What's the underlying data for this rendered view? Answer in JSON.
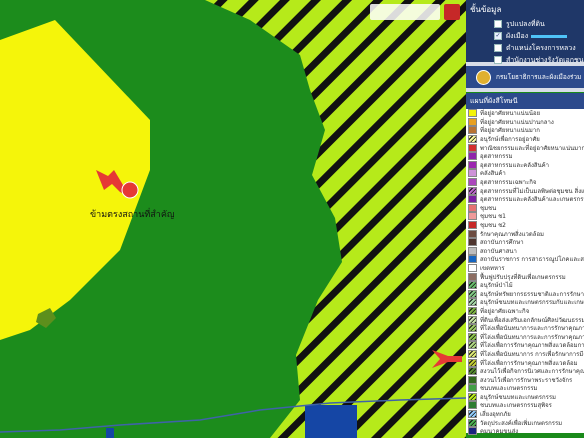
{
  "map": {
    "place_label": "ข้ามตรงสถานที่สำคัญ",
    "colors": {
      "urban": "#1c8c1c",
      "residential": "#f5f50a",
      "agri_hatch": "#b6ea1a",
      "water": "#1546a5",
      "river": "#3f63a8"
    }
  },
  "layers_panel": {
    "title": "ชั้นข้อมูล",
    "items": [
      {
        "label": "รูปแปลงที่ดิน",
        "checked": false
      },
      {
        "label": "ผังเมือง",
        "checked": true
      },
      {
        "label": "ตำแหน่งโครงการหลวง",
        "checked": false
      },
      {
        "label": "สำนักงานช่างรังวัดเอกชน",
        "checked": false
      }
    ]
  },
  "brand": {
    "title": "กรมโยธาธิการและผังเมืองร่วม"
  },
  "legend": {
    "title": "แผนที่ผังสีโทษนี",
    "items": [
      {
        "label": "ที่อยู่อาศัยหนาแน่นน้อย",
        "color": "#f5f50a",
        "hatch": false
      },
      {
        "label": "ที่อยู่อาศัยหนาแน่นปานกลาง",
        "color": "#e8a020",
        "hatch": false
      },
      {
        "label": "ที่อยู่อาศัยหนาแน่นมาก",
        "color": "#b87333",
        "hatch": false
      },
      {
        "label": "อนุรักษ์เพื่อการอยู่อาศัย",
        "color": "#f5f59a",
        "hatch": true
      },
      {
        "label": "พาณิชยกรรมและที่อยู่อาศัยหนาแน่นมาก",
        "color": "#d32f2f",
        "hatch": false
      },
      {
        "label": "อุตสาหกรรม",
        "color": "#8e24aa",
        "hatch": false
      },
      {
        "label": "อุตสาหกรรมและคลังสินค้า",
        "color": "#9c27b0",
        "hatch": false
      },
      {
        "label": "คลังสินค้า",
        "color": "#ce93d8",
        "hatch": false
      },
      {
        "label": "อุตสาหกรรมเฉพาะกิจ",
        "color": "#ab47bc",
        "hatch": false
      },
      {
        "label": "อุตสาหกรรมที่ไม่เป็นมลพิษต่อชุมชน สิ่งแวดล้อม",
        "color": "#ba68c8",
        "hatch": true
      },
      {
        "label": "อุตสาหกรรมและคลังสินค้าและเกษตรกรรม",
        "color": "#7b1fa2",
        "hatch": false
      },
      {
        "label": "ชุมชน",
        "color": "#e57373",
        "hatch": false
      },
      {
        "label": "ชุมชน ช1",
        "color": "#ef9a9a",
        "hatch": false
      },
      {
        "label": "ชุมชน ช2",
        "color": "#c62828",
        "hatch": false
      },
      {
        "label": "รักษาคุณภาพสิ่งแวดล้อม",
        "color": "#6d4c41",
        "hatch": false
      },
      {
        "label": "สถาบันการศึกษา",
        "color": "#4e342e",
        "hatch": false
      },
      {
        "label": "สถาบันศาสนา",
        "color": "#bdbdbd",
        "hatch": false
      },
      {
        "label": "สถาบันราชการ การสาธารณูปโภคและสาธารณูปการ",
        "color": "#1565c0",
        "hatch": false
      },
      {
        "label": "เขตทหาร",
        "color": "#ffffff",
        "hatch": false
      },
      {
        "label": "ฟื้นฟูปรับปรุงที่ดินเพื่อเกษตรกรรม",
        "color": "#8d6e63",
        "hatch": false
      },
      {
        "label": "อนุรักษ์ป่าไม้",
        "color": "#66bb6a",
        "hatch": true
      },
      {
        "label": "อนุรักษ์ทรัพยากรธรรมชาติและการรักษาคุณภาพ",
        "color": "#81c784",
        "hatch": true
      },
      {
        "label": "อนุรักษ์ชนบทและเกษตรกรรมกับและเกษตร",
        "color": "#a5d6a7",
        "hatch": true
      },
      {
        "label": "ที่อยู่อาศัยเฉพาะกิจ",
        "color": "#7cb342",
        "hatch": true
      },
      {
        "label": "ที่ดินเพื่อส่งเสริมเอกลักษณ์ศิลปวัฒนธรรม",
        "color": "#c5e1a5",
        "hatch": true
      },
      {
        "label": "ที่โล่งเพื่อนันทนาการและการรักษาคุณภาพสิ่ง",
        "color": "#9ccc65",
        "hatch": true
      },
      {
        "label": "ที่โล่งเพื่อนันทนาการและการรักษาคุณภาพสิ่ง",
        "color": "#8bc34a",
        "hatch": true
      },
      {
        "label": "ที่โล่งเพื่อการรักษาคุณภาพสิ่งแวดล้อมการท่อง",
        "color": "#aed581",
        "hatch": true
      },
      {
        "label": "ที่โล่งเพื่อนันทนาการ การเพื่อรักษาการมีความ",
        "color": "#dce775",
        "hatch": true
      },
      {
        "label": "ที่โล่งเพื่อการรักษาคุณภาพสิ่งแวดล้อม",
        "color": "#c0ca33",
        "hatch": true
      },
      {
        "label": "สงวนไว้เพื่อกิจการนิเวศและการรักษาคุณภาพสิ่ง",
        "color": "#558b2f",
        "hatch": true
      },
      {
        "label": "สงวนไว้เพื่อการรักษาพระราชวังจักร",
        "color": "#33691e",
        "hatch": false
      },
      {
        "label": "ชนบทและเกษตรกรรม",
        "color": "#43a047",
        "hatch": false
      },
      {
        "label": "อนุรักษ์ชนบทและเกษตรกรรม",
        "color": "#b6ea1a",
        "hatch": true
      },
      {
        "label": "ชนบทและเกษตรกรรมสุพิจร",
        "color": "#2e7d32",
        "hatch": false
      },
      {
        "label": "เสี่ยงอุทกภัย",
        "color": "#90caf9",
        "hatch": true
      },
      {
        "label": "วัตถุประสงค์เพื่อเพิ่มเกษตรกรรม",
        "color": "#4caf50",
        "hatch": true
      },
      {
        "label": "คมนาคมขนส่ง",
        "color": "#1a237e",
        "hatch": false
      }
    ]
  }
}
